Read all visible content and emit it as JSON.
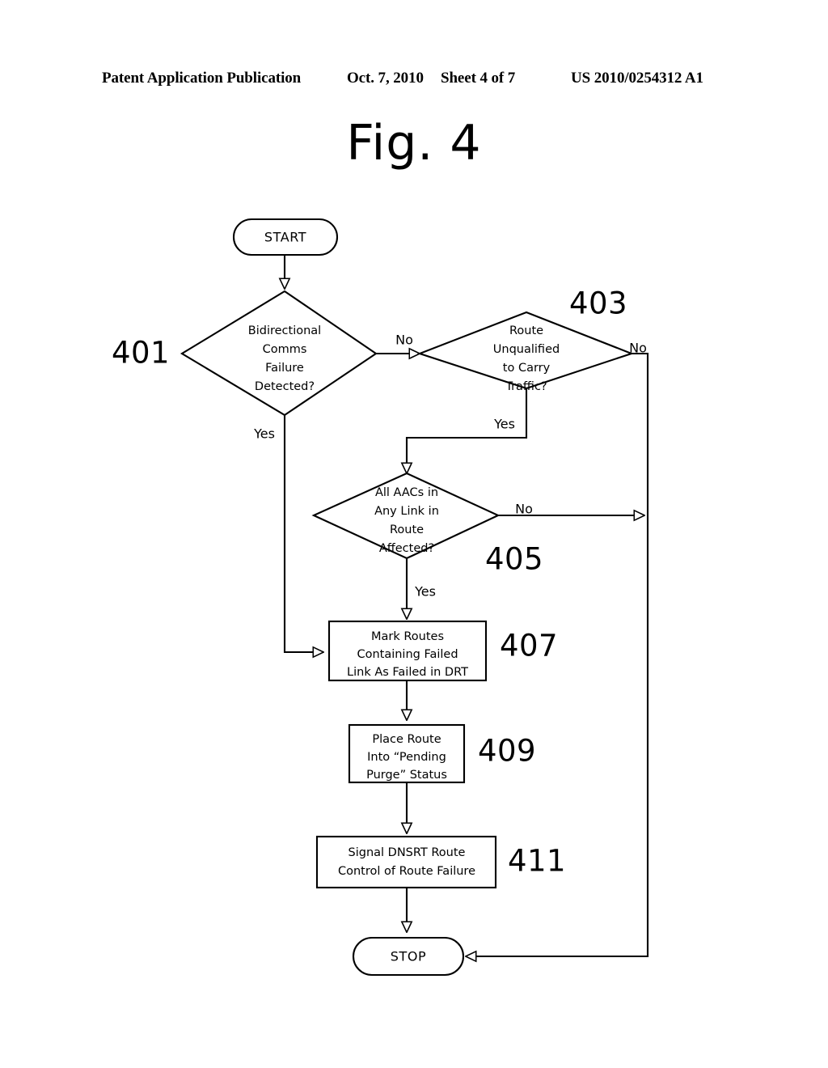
{
  "header": {
    "publication": "Patent Application Publication",
    "date": "Oct. 7, 2010",
    "sheet": "Sheet 4 of 7",
    "patent_number": "US 2010/0254312 A1"
  },
  "figure": {
    "title": "Fig. 4"
  },
  "chart_data": {
    "type": "diagram",
    "title": "Fig. 4",
    "diagram_kind": "flowchart",
    "nodes": [
      {
        "id": "start",
        "kind": "terminator",
        "label": "START",
        "ref": ""
      },
      {
        "id": "d401",
        "kind": "decision",
        "label": "Bidirectional Comms Failure Detected?",
        "ref": "401"
      },
      {
        "id": "d403",
        "kind": "decision",
        "label": "Route Unqualified to Carry Traffic?",
        "ref": "403"
      },
      {
        "id": "d405",
        "kind": "decision",
        "label": "All AACs in Any Link in Route Affected?",
        "ref": "405"
      },
      {
        "id": "p407",
        "kind": "process",
        "label": "Mark Routes Containing Failed Link As Failed in DRT",
        "ref": "407"
      },
      {
        "id": "p409",
        "kind": "process",
        "label": "Place Route Into “Pending Purge” Status",
        "ref": "409"
      },
      {
        "id": "p411",
        "kind": "process",
        "label": "Signal DNSRT Route Control of Route Failure",
        "ref": "411"
      },
      {
        "id": "stop",
        "kind": "terminator",
        "label": "STOP",
        "ref": ""
      }
    ],
    "edges": [
      {
        "from": "start",
        "to": "d401",
        "label": ""
      },
      {
        "from": "d401",
        "to": "d403",
        "label": "No"
      },
      {
        "from": "d401",
        "to": "p407",
        "label": "Yes"
      },
      {
        "from": "d403",
        "to": "d405",
        "label": "Yes"
      },
      {
        "from": "d403",
        "to": "stop",
        "label": "No"
      },
      {
        "from": "d405",
        "to": "p407",
        "label": "Yes"
      },
      {
        "from": "d405",
        "to": "stop",
        "label": "No"
      },
      {
        "from": "p407",
        "to": "p409",
        "label": ""
      },
      {
        "from": "p409",
        "to": "p411",
        "label": ""
      },
      {
        "from": "p411",
        "to": "stop",
        "label": ""
      }
    ]
  },
  "nodes": {
    "start": {
      "label": "START"
    },
    "stop": {
      "label": "STOP"
    },
    "d401": {
      "ref": "401",
      "line1": "Bidirectional",
      "line2": "Comms",
      "line3": "Failure",
      "line4": "Detected?"
    },
    "d403": {
      "ref": "403",
      "line1": "Route",
      "line2": "Unqualified",
      "line3": "to Carry",
      "line4": "Traffic?"
    },
    "d405": {
      "ref": "405",
      "line1": "All AACs  in",
      "line2": "Any Link in",
      "line3": "Route",
      "line4": "Affected?"
    },
    "p407": {
      "ref": "407",
      "line1": "Mark Routes",
      "line2": "Containing Failed",
      "line3": "Link As Failed in DRT"
    },
    "p409": {
      "ref": "409",
      "line1": "Place Route",
      "line2": "Into “Pending",
      "line3": "Purge” Status"
    },
    "p411": {
      "ref": "411",
      "line1": "Signal DNSRT Route",
      "line2": "Control of Route Failure"
    }
  },
  "edge_labels": {
    "no_401_403": "No",
    "yes_401": "Yes",
    "no_403": "No",
    "yes_403": "Yes",
    "no_405": "No",
    "yes_405": "Yes"
  },
  "colors": {
    "ink": "#000000",
    "paper": "#ffffff"
  }
}
